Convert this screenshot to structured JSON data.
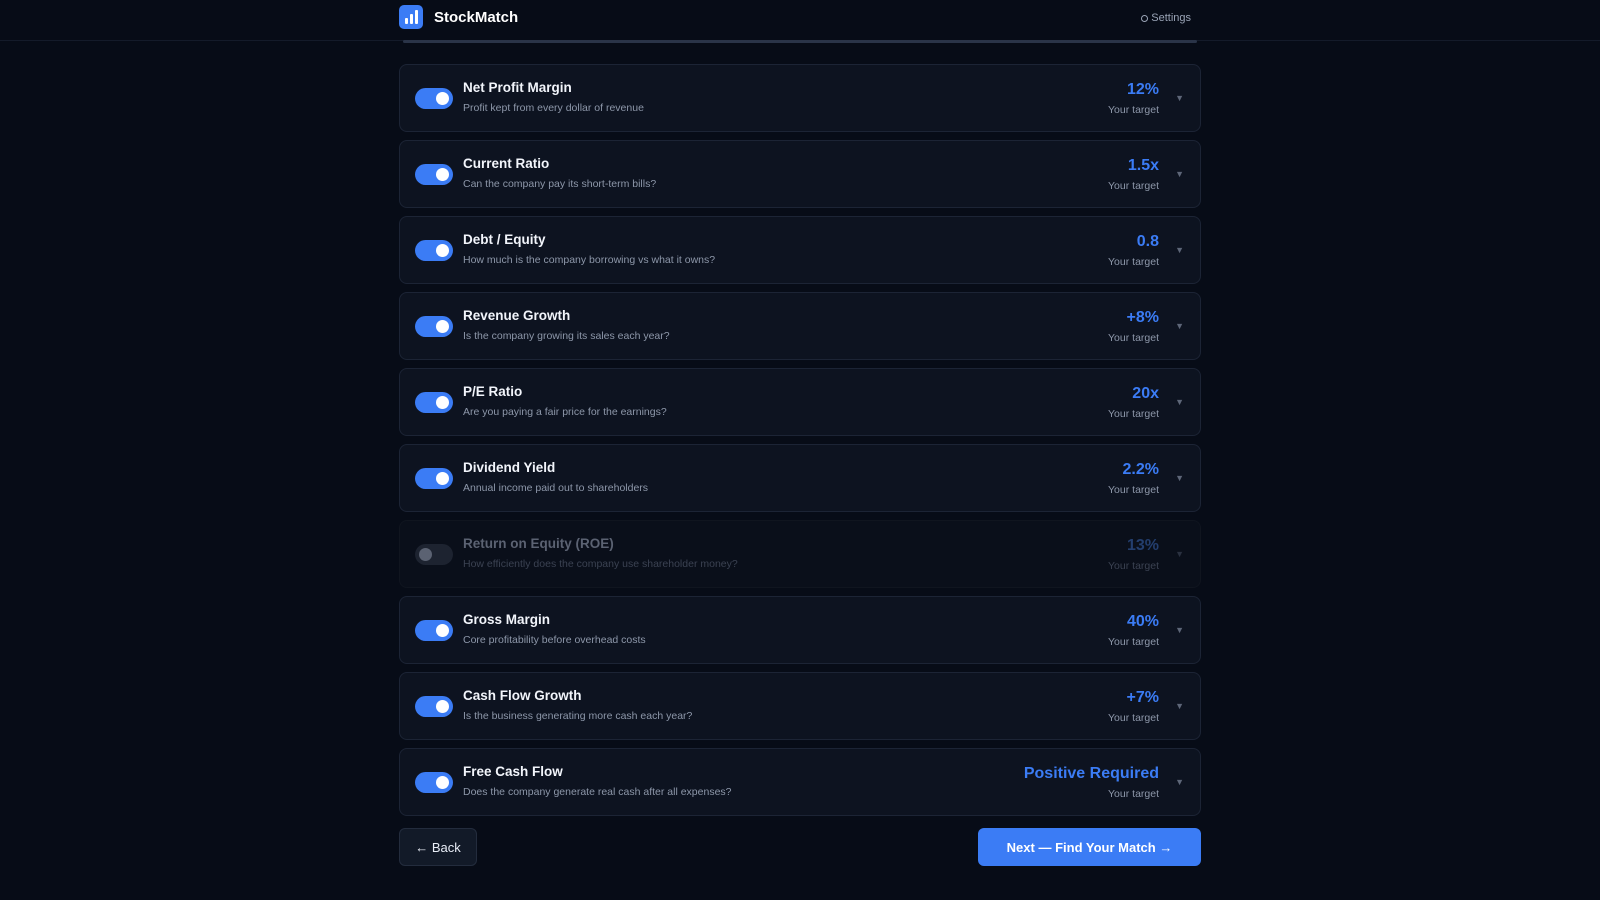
{
  "header": {
    "app_name": "StockMatch",
    "logo_icon": "bar-chart-icon",
    "settings_label": "Settings",
    "settings_icon": "gear-icon"
  },
  "progress": {
    "fraction": 1.0
  },
  "accent_color": "#3b7cf5",
  "metrics": [
    {
      "title": "Net Profit Margin",
      "description": "Profit kept from every dollar of revenue",
      "target": "12%",
      "target_label": "Your target",
      "enabled": true
    },
    {
      "title": "Current Ratio",
      "description": "Can the company pay its short-term bills?",
      "target": "1.5x",
      "target_label": "Your target",
      "enabled": true
    },
    {
      "title": "Debt / Equity",
      "description": "How much is the company borrowing vs what it owns?",
      "target": "0.8",
      "target_label": "Your target",
      "enabled": true
    },
    {
      "title": "Revenue Growth",
      "description": "Is the company growing its sales each year?",
      "target": "+8%",
      "target_label": "Your target",
      "enabled": true
    },
    {
      "title": "P/E Ratio",
      "description": "Are you paying a fair price for the earnings?",
      "target": "20x",
      "target_label": "Your target",
      "enabled": true
    },
    {
      "title": "Dividend Yield",
      "description": "Annual income paid out to shareholders",
      "target": "2.2%",
      "target_label": "Your target",
      "enabled": true
    },
    {
      "title": "Return on Equity (ROE)",
      "description": "How efficiently does the company use shareholder money?",
      "target": "13%",
      "target_label": "Your target",
      "enabled": false
    },
    {
      "title": "Gross Margin",
      "description": "Core profitability before overhead costs",
      "target": "40%",
      "target_label": "Your target",
      "enabled": true
    },
    {
      "title": "Cash Flow Growth",
      "description": "Is the business generating more cash each year?",
      "target": "+7%",
      "target_label": "Your target",
      "enabled": true
    },
    {
      "title": "Free Cash Flow",
      "description": "Does the company generate real cash after all expenses?",
      "target": "Positive Required",
      "target_label": "Your target",
      "enabled": true
    }
  ],
  "footer": {
    "back_label": "← Back",
    "next_label": "Next — Find Your Match →"
  }
}
